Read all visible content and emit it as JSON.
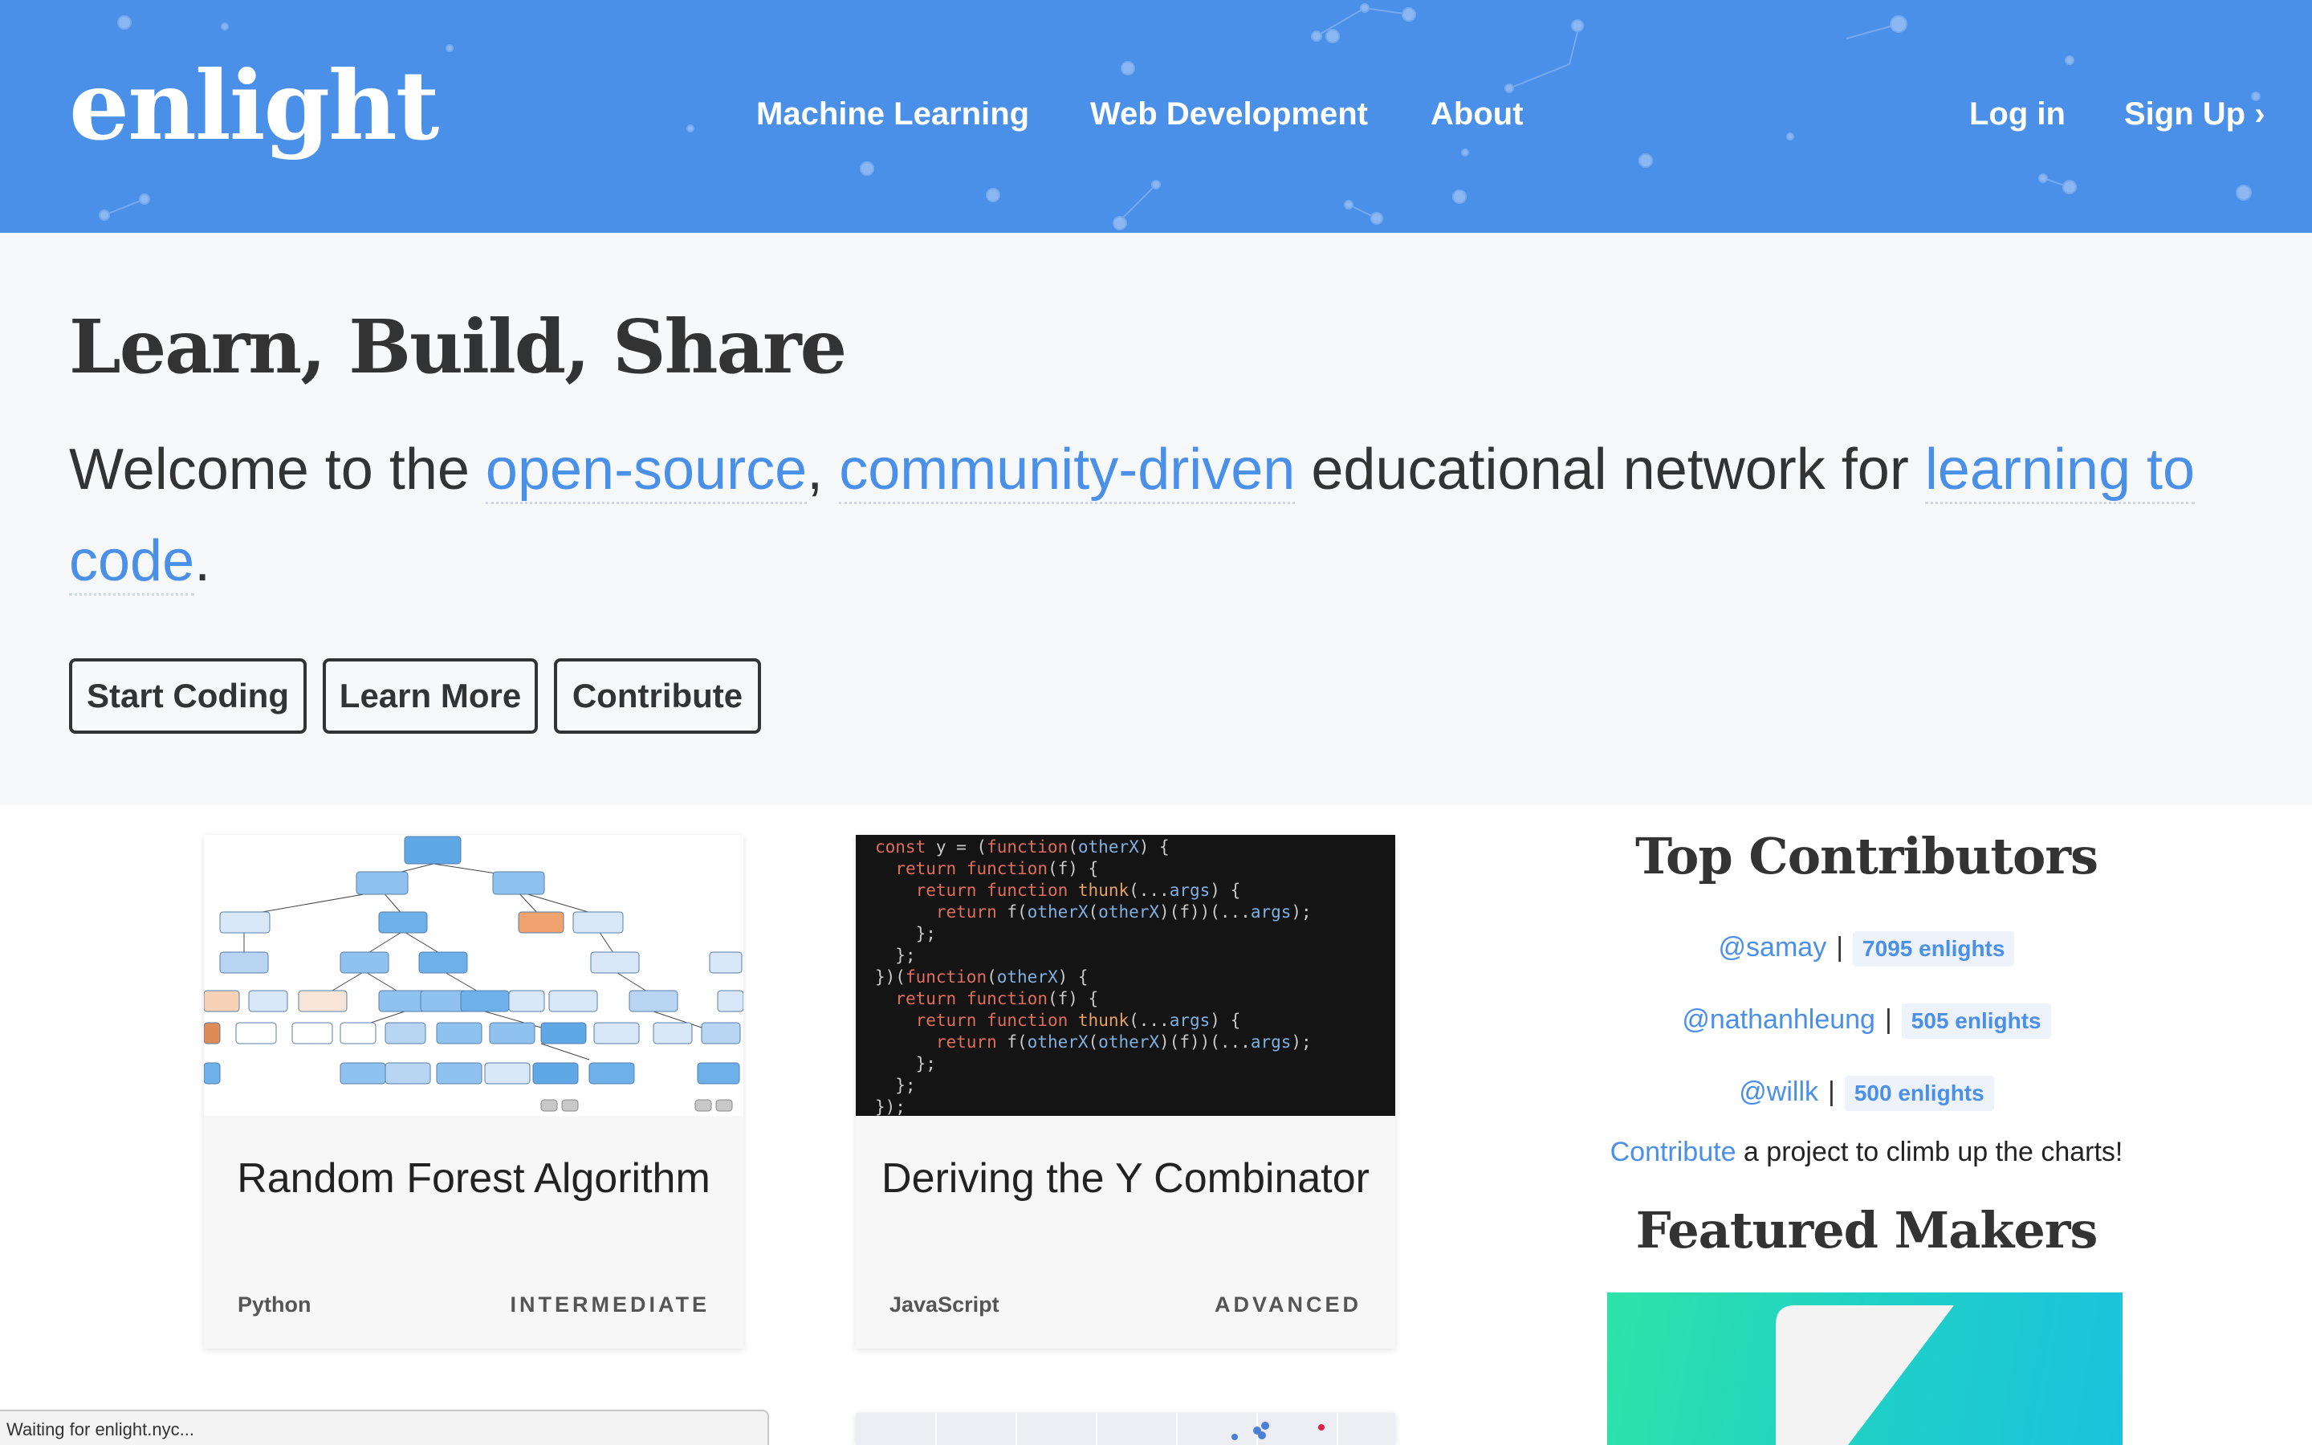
{
  "brand": {
    "logo": "enlight",
    "accent": "#4a8fe8",
    "header_bg": "#4a8fe8"
  },
  "nav": {
    "links": [
      "Machine Learning",
      "Web Development",
      "About"
    ],
    "login": "Log in",
    "signup": "Sign Up ›"
  },
  "hero": {
    "title": "Learn, Build, Share",
    "sub_prefix": "Welcome to the ",
    "sub_link1": "open-source",
    "sub_comma": ", ",
    "sub_link2": "community-driven",
    "sub_middle": " educational network for ",
    "sub_link3": "learning to code",
    "sub_end": ".",
    "buttons": [
      "Start Coding",
      "Learn More",
      "Contribute"
    ]
  },
  "cards": [
    {
      "title": "Random Forest Algorithm",
      "language": "Python",
      "level": "INTERMEDIATE",
      "thumb_icon": "decision-tree-diagram"
    },
    {
      "title": "Deriving the Y Combinator",
      "language": "JavaScript",
      "level": "ADVANCED",
      "thumb_icon": "code-snippet"
    }
  ],
  "code_lines": [
    "const y = (function(otherX) {",
    "  return function(f) {",
    "    return function thunk(...args) {",
    "      return f(otherX(otherX)(f))(...args);",
    "    };",
    "  };",
    "})(function(otherX) {",
    "  return function(f) {",
    "    return function thunk(...args) {",
    "      return f(otherX(otherX)(f))(...args);",
    "    };",
    "  };",
    "});"
  ],
  "sidebar": {
    "top_title": "Top Contributors",
    "contributors": [
      {
        "handle": "@samay",
        "count": "7095 enlights"
      },
      {
        "handle": "@nathanhleung",
        "count": "505 enlights"
      },
      {
        "handle": "@willk",
        "count": "500 enlights"
      }
    ],
    "note_link": "Contribute",
    "note_text": " a project to climb up the charts!",
    "makers_title": "Featured Makers"
  },
  "status": "Waiting for enlight.nyc..."
}
